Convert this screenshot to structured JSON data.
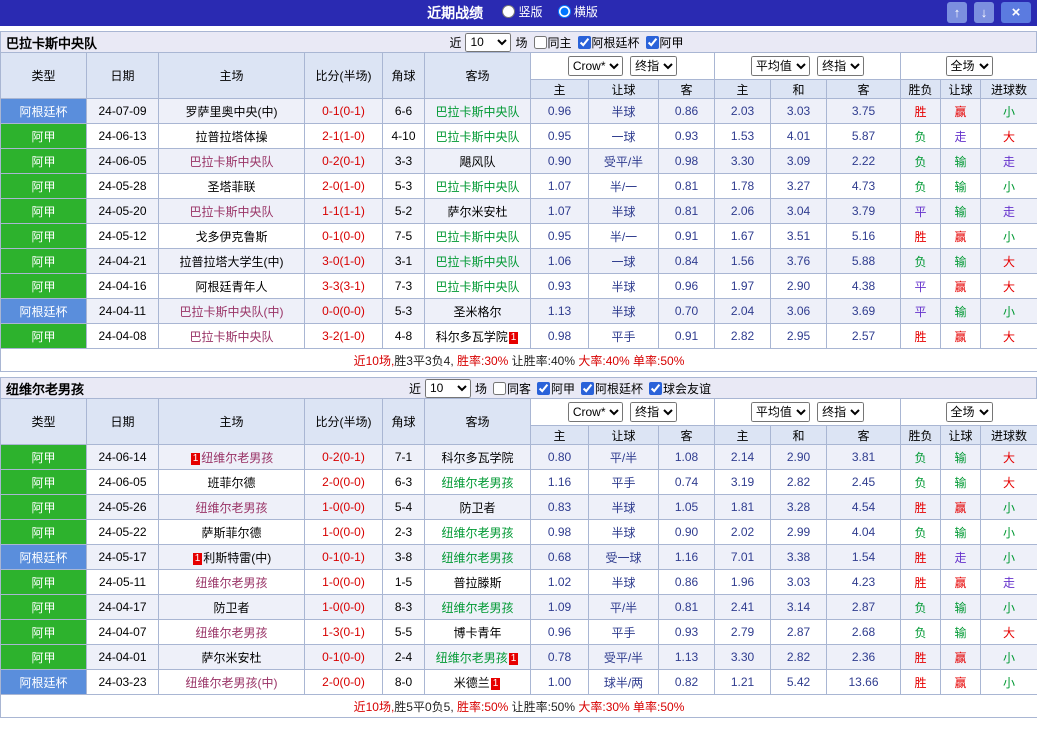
{
  "topbar": {
    "title": "近期战绩",
    "radios": [
      {
        "label": "竖版",
        "checked": false
      },
      {
        "label": "横版",
        "checked": true
      }
    ],
    "up_icon": "↑",
    "down_icon": "↓",
    "close_icon": "×"
  },
  "columns": {
    "type": "类型",
    "date": "日期",
    "home": "主场",
    "score": "比分(半场)",
    "corner": "角球",
    "away": "客场",
    "dd": [
      "Crow*",
      "终指",
      "平均值",
      "终指",
      "全场"
    ],
    "sub": [
      "主",
      "让球",
      "客",
      "主",
      "和",
      "客",
      "胜负",
      "让球",
      "进球数"
    ]
  },
  "colors": {
    "topbar_bg": "#2a2ab2",
    "cup_type_bg": "#5a8edc",
    "league_type_bg": "#2db22d",
    "score_red": "#d70000",
    "focal_home_team": "#993366",
    "focal_away_team": "#009933",
    "result_red": "#e60000",
    "result_green": "#009933",
    "result_purple": "#6633cc"
  },
  "sections": [
    {
      "title": "巴拉卡斯中央队",
      "controls": {
        "near": "近",
        "count": "10",
        "unit": "场",
        "same": {
          "label": "同主",
          "checked": false
        },
        "leagues": [
          {
            "label": "阿根廷杯",
            "checked": true
          },
          {
            "label": "阿甲",
            "checked": true
          }
        ]
      },
      "rows": [
        {
          "type": "阿根廷杯",
          "tc": "cup",
          "date": "24-07-09",
          "home": {
            "t": "罗萨里奥中央(中)",
            "c": "n"
          },
          "score": "0-1(0-1)",
          "corner": "6-6",
          "away": {
            "t": "巴拉卡斯中央队",
            "c": "a"
          },
          "odds": [
            "0.96",
            "半球",
            "0.86",
            "2.03",
            "3.03",
            "3.75"
          ],
          "res": [
            [
              "胜",
              "r"
            ],
            [
              "赢",
              "r"
            ],
            [
              "小",
              "g"
            ]
          ]
        },
        {
          "type": "阿甲",
          "tc": "lg",
          "date": "24-06-13",
          "home": {
            "t": "拉普拉塔体操",
            "c": "n"
          },
          "score": "2-1(1-0)",
          "corner": "4-10",
          "away": {
            "t": "巴拉卡斯中央队",
            "c": "a"
          },
          "odds": [
            "0.95",
            "一球",
            "0.93",
            "1.53",
            "4.01",
            "5.87"
          ],
          "res": [
            [
              "负",
              "g"
            ],
            [
              "走",
              "p"
            ],
            [
              "大",
              "r"
            ]
          ]
        },
        {
          "type": "阿甲",
          "tc": "lg",
          "date": "24-06-05",
          "home": {
            "t": "巴拉卡斯中央队",
            "c": "h"
          },
          "score": "0-2(0-1)",
          "corner": "3-3",
          "away": {
            "t": "飓风队",
            "c": "n"
          },
          "odds": [
            "0.90",
            "受平/半",
            "0.98",
            "3.30",
            "3.09",
            "2.22"
          ],
          "res": [
            [
              "负",
              "g"
            ],
            [
              "输",
              "g"
            ],
            [
              "走",
              "p"
            ]
          ]
        },
        {
          "type": "阿甲",
          "tc": "lg",
          "date": "24-05-28",
          "home": {
            "t": "圣塔菲联",
            "c": "n"
          },
          "score": "2-0(1-0)",
          "corner": "5-3",
          "away": {
            "t": "巴拉卡斯中央队",
            "c": "a"
          },
          "odds": [
            "1.07",
            "半/一",
            "0.81",
            "1.78",
            "3.27",
            "4.73"
          ],
          "res": [
            [
              "负",
              "g"
            ],
            [
              "输",
              "g"
            ],
            [
              "小",
              "g"
            ]
          ]
        },
        {
          "type": "阿甲",
          "tc": "lg",
          "date": "24-05-20",
          "home": {
            "t": "巴拉卡斯中央队",
            "c": "h"
          },
          "score": "1-1(1-1)",
          "corner": "5-2",
          "away": {
            "t": "萨尔米安杜",
            "c": "n"
          },
          "odds": [
            "1.07",
            "半球",
            "0.81",
            "2.06",
            "3.04",
            "3.79"
          ],
          "res": [
            [
              "平",
              "p"
            ],
            [
              "输",
              "g"
            ],
            [
              "走",
              "p"
            ]
          ]
        },
        {
          "type": "阿甲",
          "tc": "lg",
          "date": "24-05-12",
          "home": {
            "t": "戈多伊克鲁斯",
            "c": "n"
          },
          "score": "0-1(0-0)",
          "corner": "7-5",
          "away": {
            "t": "巴拉卡斯中央队",
            "c": "a"
          },
          "odds": [
            "0.95",
            "半/一",
            "0.91",
            "1.67",
            "3.51",
            "5.16"
          ],
          "res": [
            [
              "胜",
              "r"
            ],
            [
              "赢",
              "r"
            ],
            [
              "小",
              "g"
            ]
          ]
        },
        {
          "type": "阿甲",
          "tc": "lg",
          "date": "24-04-21",
          "home": {
            "t": "拉普拉塔大学生(中)",
            "c": "n"
          },
          "score": "3-0(1-0)",
          "corner": "3-1",
          "away": {
            "t": "巴拉卡斯中央队",
            "c": "a"
          },
          "odds": [
            "1.06",
            "一球",
            "0.84",
            "1.56",
            "3.76",
            "5.88"
          ],
          "res": [
            [
              "负",
              "g"
            ],
            [
              "输",
              "g"
            ],
            [
              "大",
              "r"
            ]
          ]
        },
        {
          "type": "阿甲",
          "tc": "lg",
          "date": "24-04-16",
          "home": {
            "t": "阿根廷青年人",
            "c": "n"
          },
          "score": "3-3(3-1)",
          "corner": "7-3",
          "away": {
            "t": "巴拉卡斯中央队",
            "c": "a"
          },
          "odds": [
            "0.93",
            "半球",
            "0.96",
            "1.97",
            "2.90",
            "4.38"
          ],
          "res": [
            [
              "平",
              "p"
            ],
            [
              "赢",
              "r"
            ],
            [
              "大",
              "r"
            ]
          ]
        },
        {
          "type": "阿根廷杯",
          "tc": "cup",
          "date": "24-04-11",
          "home": {
            "t": "巴拉卡斯中央队(中)",
            "c": "h"
          },
          "score": "0-0(0-0)",
          "corner": "5-3",
          "away": {
            "t": "圣米格尔",
            "c": "n"
          },
          "odds": [
            "1.13",
            "半球",
            "0.70",
            "2.04",
            "3.06",
            "3.69"
          ],
          "res": [
            [
              "平",
              "p"
            ],
            [
              "输",
              "g"
            ],
            [
              "小",
              "g"
            ]
          ]
        },
        {
          "type": "阿甲",
          "tc": "lg",
          "date": "24-04-08",
          "home": {
            "t": "巴拉卡斯中央队",
            "c": "h"
          },
          "score": "3-2(1-0)",
          "corner": "4-8",
          "away": {
            "t": "科尔多瓦学院",
            "c": "n",
            "post": "1"
          },
          "odds": [
            "0.98",
            "平手",
            "0.91",
            "2.82",
            "2.95",
            "2.57"
          ],
          "res": [
            [
              "胜",
              "r"
            ],
            [
              "赢",
              "r"
            ],
            [
              "大",
              "r"
            ]
          ]
        }
      ],
      "summary": [
        {
          "t": "近10场,",
          "c": "r"
        },
        {
          "t": "胜3平3负4,",
          "c": "k"
        },
        {
          "t": " 胜率:30%",
          "c": "r"
        },
        {
          "t": " 让胜率:40%",
          "c": "k"
        },
        {
          "t": " 大率:40%",
          "c": "r"
        },
        {
          "t": " 单率:50%",
          "c": "r"
        }
      ]
    },
    {
      "title": "纽维尔老男孩",
      "controls": {
        "near": "近",
        "count": "10",
        "unit": "场",
        "same": {
          "label": "同客",
          "checked": false
        },
        "leagues": [
          {
            "label": "阿甲",
            "checked": true
          },
          {
            "label": "阿根廷杯",
            "checked": true
          },
          {
            "label": "球会友谊",
            "checked": true
          }
        ]
      },
      "rows": [
        {
          "type": "阿甲",
          "tc": "lg",
          "date": "24-06-14",
          "home": {
            "t": "纽维尔老男孩",
            "c": "h",
            "pre": "1"
          },
          "score": "0-2(0-1)",
          "corner": "7-1",
          "away": {
            "t": "科尔多瓦学院",
            "c": "n"
          },
          "odds": [
            "0.80",
            "平/半",
            "1.08",
            "2.14",
            "2.90",
            "3.81"
          ],
          "res": [
            [
              "负",
              "g"
            ],
            [
              "输",
              "g"
            ],
            [
              "大",
              "r"
            ]
          ]
        },
        {
          "type": "阿甲",
          "tc": "lg",
          "date": "24-06-05",
          "home": {
            "t": "班菲尔德",
            "c": "n"
          },
          "score": "2-0(0-0)",
          "corner": "6-3",
          "away": {
            "t": "纽维尔老男孩",
            "c": "a"
          },
          "odds": [
            "1.16",
            "平手",
            "0.74",
            "3.19",
            "2.82",
            "2.45"
          ],
          "res": [
            [
              "负",
              "g"
            ],
            [
              "输",
              "g"
            ],
            [
              "大",
              "r"
            ]
          ]
        },
        {
          "type": "阿甲",
          "tc": "lg",
          "date": "24-05-26",
          "home": {
            "t": "纽维尔老男孩",
            "c": "h"
          },
          "score": "1-0(0-0)",
          "corner": "5-4",
          "away": {
            "t": "防卫者",
            "c": "n"
          },
          "odds": [
            "0.83",
            "半球",
            "1.05",
            "1.81",
            "3.28",
            "4.54"
          ],
          "res": [
            [
              "胜",
              "r"
            ],
            [
              "赢",
              "r"
            ],
            [
              "小",
              "g"
            ]
          ]
        },
        {
          "type": "阿甲",
          "tc": "lg",
          "date": "24-05-22",
          "home": {
            "t": "萨斯菲尔德",
            "c": "n"
          },
          "score": "1-0(0-0)",
          "corner": "2-3",
          "away": {
            "t": "纽维尔老男孩",
            "c": "a"
          },
          "odds": [
            "0.98",
            "半球",
            "0.90",
            "2.02",
            "2.99",
            "4.04"
          ],
          "res": [
            [
              "负",
              "g"
            ],
            [
              "输",
              "g"
            ],
            [
              "小",
              "g"
            ]
          ]
        },
        {
          "type": "阿根廷杯",
          "tc": "cup",
          "date": "24-05-17",
          "home": {
            "t": "利斯特雷(中)",
            "c": "n",
            "pre": "1"
          },
          "score": "0-1(0-1)",
          "corner": "3-8",
          "away": {
            "t": "纽维尔老男孩",
            "c": "a"
          },
          "odds": [
            "0.68",
            "受一球",
            "1.16",
            "7.01",
            "3.38",
            "1.54"
          ],
          "res": [
            [
              "胜",
              "r"
            ],
            [
              "走",
              "p"
            ],
            [
              "小",
              "g"
            ]
          ]
        },
        {
          "type": "阿甲",
          "tc": "lg",
          "date": "24-05-11",
          "home": {
            "t": "纽维尔老男孩",
            "c": "h"
          },
          "score": "1-0(0-0)",
          "corner": "1-5",
          "away": {
            "t": "普拉滕斯",
            "c": "n"
          },
          "odds": [
            "1.02",
            "半球",
            "0.86",
            "1.96",
            "3.03",
            "4.23"
          ],
          "res": [
            [
              "胜",
              "r"
            ],
            [
              "赢",
              "r"
            ],
            [
              "走",
              "p"
            ]
          ]
        },
        {
          "type": "阿甲",
          "tc": "lg",
          "date": "24-04-17",
          "home": {
            "t": "防卫者",
            "c": "n"
          },
          "score": "1-0(0-0)",
          "corner": "8-3",
          "away": {
            "t": "纽维尔老男孩",
            "c": "a"
          },
          "odds": [
            "1.09",
            "平/半",
            "0.81",
            "2.41",
            "3.14",
            "2.87"
          ],
          "res": [
            [
              "负",
              "g"
            ],
            [
              "输",
              "g"
            ],
            [
              "小",
              "g"
            ]
          ]
        },
        {
          "type": "阿甲",
          "tc": "lg",
          "date": "24-04-07",
          "home": {
            "t": "纽维尔老男孩",
            "c": "h"
          },
          "score": "1-3(0-1)",
          "corner": "5-5",
          "away": {
            "t": "博卡青年",
            "c": "n"
          },
          "odds": [
            "0.96",
            "平手",
            "0.93",
            "2.79",
            "2.87",
            "2.68"
          ],
          "res": [
            [
              "负",
              "g"
            ],
            [
              "输",
              "g"
            ],
            [
              "大",
              "r"
            ]
          ]
        },
        {
          "type": "阿甲",
          "tc": "lg",
          "date": "24-04-01",
          "home": {
            "t": "萨尔米安杜",
            "c": "n"
          },
          "score": "0-1(0-0)",
          "corner": "2-4",
          "away": {
            "t": "纽维尔老男孩",
            "c": "a",
            "post": "1"
          },
          "odds": [
            "0.78",
            "受平/半",
            "1.13",
            "3.30",
            "2.82",
            "2.36"
          ],
          "res": [
            [
              "胜",
              "r"
            ],
            [
              "赢",
              "r"
            ],
            [
              "小",
              "g"
            ]
          ]
        },
        {
          "type": "阿根廷杯",
          "tc": "cup",
          "date": "24-03-23",
          "home": {
            "t": "纽维尔老男孩(中)",
            "c": "h"
          },
          "score": "2-0(0-0)",
          "corner": "8-0",
          "away": {
            "t": "米德兰",
            "c": "n",
            "post": "1"
          },
          "odds": [
            "1.00",
            "球半/两",
            "0.82",
            "1.21",
            "5.42",
            "13.66"
          ],
          "res": [
            [
              "胜",
              "r"
            ],
            [
              "赢",
              "r"
            ],
            [
              "小",
              "g"
            ]
          ]
        }
      ],
      "summary": [
        {
          "t": "近10场,",
          "c": "r"
        },
        {
          "t": "胜5平0负5,",
          "c": "k"
        },
        {
          "t": " 胜率:50%",
          "c": "r"
        },
        {
          "t": " 让胜率:50%",
          "c": "k"
        },
        {
          "t": " 大率:30%",
          "c": "r"
        },
        {
          "t": " 单率:50%",
          "c": "r"
        }
      ]
    }
  ]
}
